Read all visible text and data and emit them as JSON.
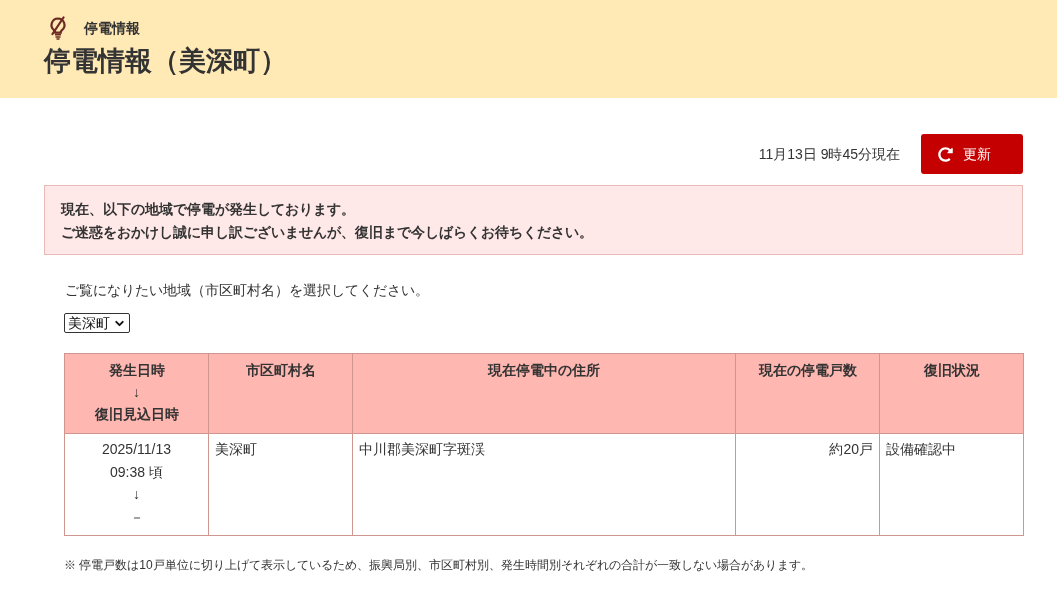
{
  "header": {
    "breadcrumb": "停電情報",
    "title": "停電情報（美深町）"
  },
  "timestamp": "11月13日 9時45分現在",
  "refresh_button": {
    "label": "更新"
  },
  "alert": {
    "lines": [
      "現在、以下の地域で停電が発生しております。",
      "ご迷惑をおかけし誠に申し訳ございませんが、復旧まで今しばらくお待ちください。"
    ]
  },
  "region_prompt": "ご覧になりたい地域（市区町村名）を選択してください。",
  "region_select": {
    "value": "美深町"
  },
  "table": {
    "columns": [
      {
        "lines": [
          "発生日時",
          "↓",
          "復旧見込日時"
        ]
      },
      {
        "lines": [
          "市区町村名"
        ]
      },
      {
        "lines": [
          "現在停電中の住所"
        ]
      },
      {
        "lines": [
          "現在の停電戸数"
        ]
      },
      {
        "lines": [
          "復旧状況"
        ]
      }
    ],
    "rows": [
      {
        "cells": [
          {
            "lines": [
              "2025/11/13",
              "09:38 頃",
              "↓",
              "－"
            ]
          },
          {
            "lines": [
              "美深町"
            ]
          },
          {
            "lines": [
              "中川郡美深町字斑渓"
            ]
          },
          {
            "lines": [
              "約20戸"
            ]
          },
          {
            "lines": [
              "設備確認中"
            ]
          }
        ]
      }
    ]
  },
  "footnote": "※ 停電戸数は10戸単位に切り上げて表示しているため、振興局別、市区町村別、発生時間別それぞれの合計が一致しない場合があります。"
}
